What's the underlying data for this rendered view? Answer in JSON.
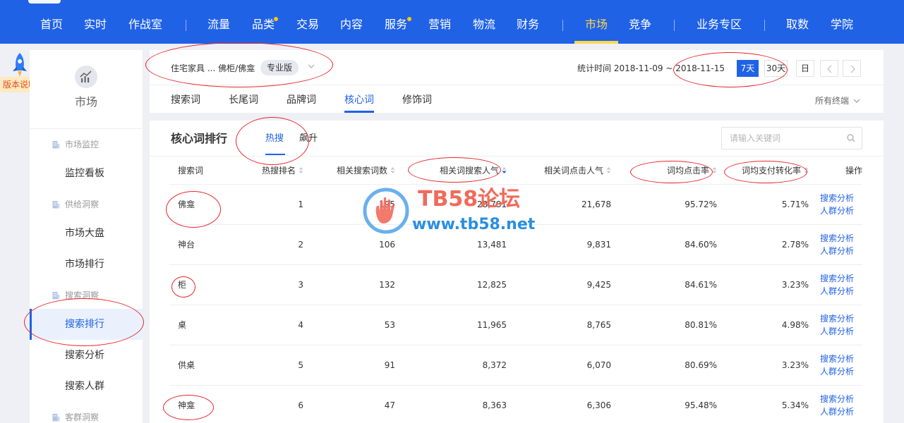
{
  "topnav": {
    "items": [
      "首页",
      "实时",
      "作战室",
      "流量",
      "品类",
      "交易",
      "内容",
      "服务",
      "营销",
      "物流",
      "财务",
      "市场",
      "竞争",
      "业务专区",
      "取数",
      "学院"
    ],
    "active": "市场"
  },
  "version_note": "版本说明",
  "sidebar": {
    "title": "市场",
    "groups": {
      "monitor": "市场监控",
      "supply": "供给洞察",
      "search": "搜索洞察",
      "customer": "客群洞察"
    },
    "items": {
      "monitor_board": "监控看板",
      "market_overview": "市场大盘",
      "market_rank": "市场排行",
      "search_rank": "搜索排行",
      "search_analysis": "搜索分析",
      "search_crowd": "搜索人群"
    }
  },
  "header": {
    "breadcrumb": "住宅家具 ... 佛柜/佛龛",
    "badge": "专业版",
    "stat_time": "统计时间 2018-11-09 ~ 2018-11-15",
    "ranges": [
      "7天",
      "30天",
      "日"
    ],
    "active_range": "7天",
    "tabs": [
      "搜索词",
      "长尾词",
      "品牌词",
      "核心词",
      "修饰词"
    ],
    "active_tab": "核心词",
    "terminal": "所有终端"
  },
  "main": {
    "title": "核心词排行",
    "subtabs": [
      "热搜",
      "飙升"
    ],
    "active_subtab": "热搜",
    "search_placeholder": "请输入关键词",
    "columns": [
      "搜索词",
      "热搜排名",
      "相关搜索词数",
      "相关词搜索人气",
      "相关词点击人气",
      "词均点击率",
      "词均支付转化率",
      "操作"
    ],
    "rows": [
      {
        "kw": "佛龛",
        "rank": "1",
        "count": "195",
        "search_pop": "28,781",
        "click_pop": "21,678",
        "ctr": "95.72%",
        "cvr": "5.71%"
      },
      {
        "kw": "神台",
        "rank": "2",
        "count": "106",
        "search_pop": "13,481",
        "click_pop": "9,831",
        "ctr": "84.60%",
        "cvr": "2.78%"
      },
      {
        "kw": "柜",
        "rank": "3",
        "count": "132",
        "search_pop": "12,825",
        "click_pop": "9,425",
        "ctr": "84.61%",
        "cvr": "3.23%"
      },
      {
        "kw": "桌",
        "rank": "4",
        "count": "53",
        "search_pop": "11,965",
        "click_pop": "8,765",
        "ctr": "80.81%",
        "cvr": "4.98%"
      },
      {
        "kw": "供桌",
        "rank": "5",
        "count": "91",
        "search_pop": "8,372",
        "click_pop": "6,070",
        "ctr": "80.69%",
        "cvr": "3.23%"
      },
      {
        "kw": "神龛",
        "rank": "6",
        "count": "47",
        "search_pop": "8,363",
        "click_pop": "6,306",
        "ctr": "95.48%",
        "cvr": "5.34%"
      }
    ],
    "actions": [
      "搜索分析",
      "人群分析"
    ]
  },
  "watermark": {
    "title": "TB58论坛",
    "url": "www.tb58.net"
  },
  "colors": {
    "brand": "#2062e6",
    "nav_active": "#ffd84a",
    "annotation": "#e8272b"
  }
}
